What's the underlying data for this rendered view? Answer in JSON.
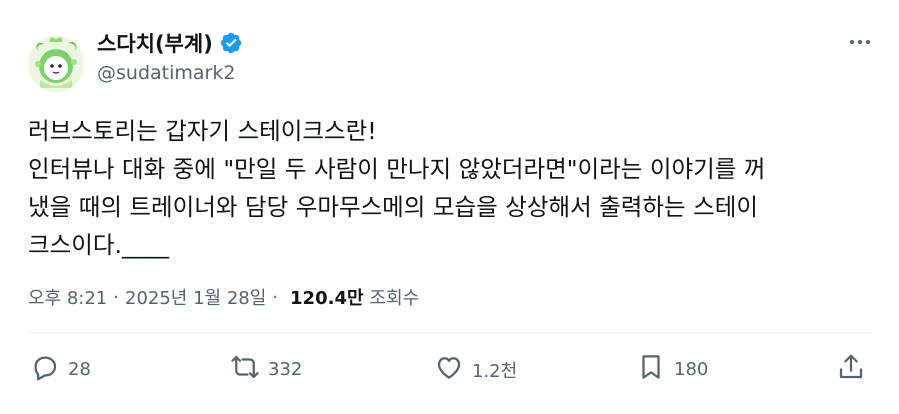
{
  "author": {
    "display_name": "스다치(부계)",
    "handle": "@sudatimark2",
    "verified": true,
    "avatar_icon": "frog-mascot-avatar"
  },
  "tweet": {
    "lines": [
      "러브스토리는 갑자기 스테이크스란!",
      "인터뷰나 대화 중에 \"만일 두 사람이 만나지 않았더라면\"이라는 이야기를 꺼",
      "냈을 때의 트레이너와 담당 우마무스메의 모습을 상상해서 출력하는 스테이",
      "크스이다.____"
    ]
  },
  "meta": {
    "time": "오후 8:21",
    "separator": "·",
    "date": "2025년 1월 28일",
    "views": "120.4만",
    "views_label": "조회수"
  },
  "actions": {
    "reply_count": "28",
    "retweet_count": "332",
    "like_count": "1.2천",
    "bookmark_count": "180"
  },
  "colors": {
    "text": "#0f1419",
    "secondary": "#536471",
    "verified": "#1d9bf0",
    "divider": "#eff3f4"
  }
}
